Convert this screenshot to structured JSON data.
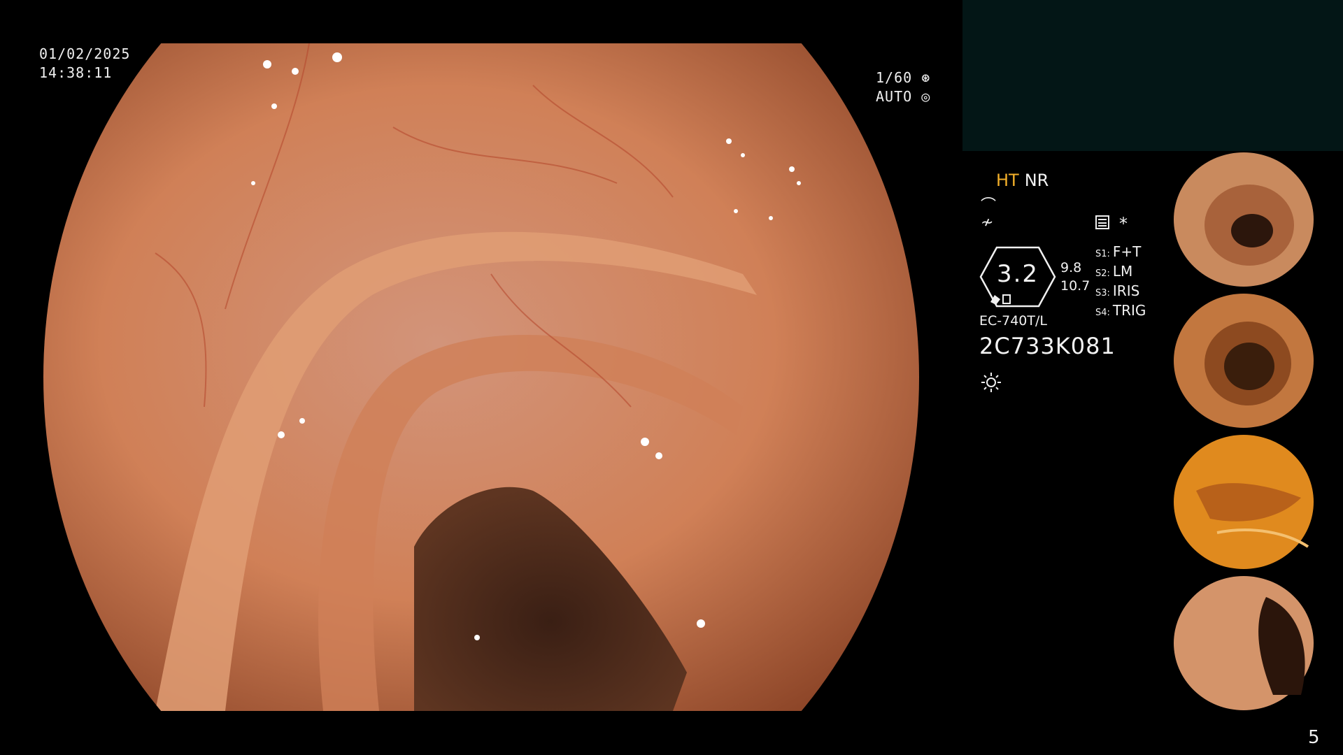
{
  "osd": {
    "date": "01/02/2025",
    "time": "14:38:11",
    "shutter": "1/60",
    "iris_mode": "AUTO"
  },
  "panel": {
    "mode_ht": "HT",
    "mode_nr": "NR",
    "zoom_value": "3.2",
    "zoom_side_top": "9.8",
    "zoom_side_bottom": "10.7",
    "settings": [
      {
        "key": "S1:",
        "value": "F+T"
      },
      {
        "key": "S2:",
        "value": "LM"
      },
      {
        "key": "S3:",
        "value": "IRIS"
      },
      {
        "key": "S4:",
        "value": "TRIG"
      }
    ],
    "scope_model": "EC-740T/L",
    "scope_serial": "2C733K081",
    "light_icon": "sun-icon",
    "record_icon": "record-icon",
    "star_symbol": "*"
  },
  "thumbnails": [
    {
      "label": "capture-1"
    },
    {
      "label": "capture-2"
    },
    {
      "label": "capture-3"
    },
    {
      "label": "capture-4"
    }
  ],
  "page_number": "5",
  "colors": {
    "ht_accent": "#f3b02a",
    "panel_bg": "#031616",
    "tissue": "#d98a5c",
    "lumen": "#3a1e12"
  }
}
